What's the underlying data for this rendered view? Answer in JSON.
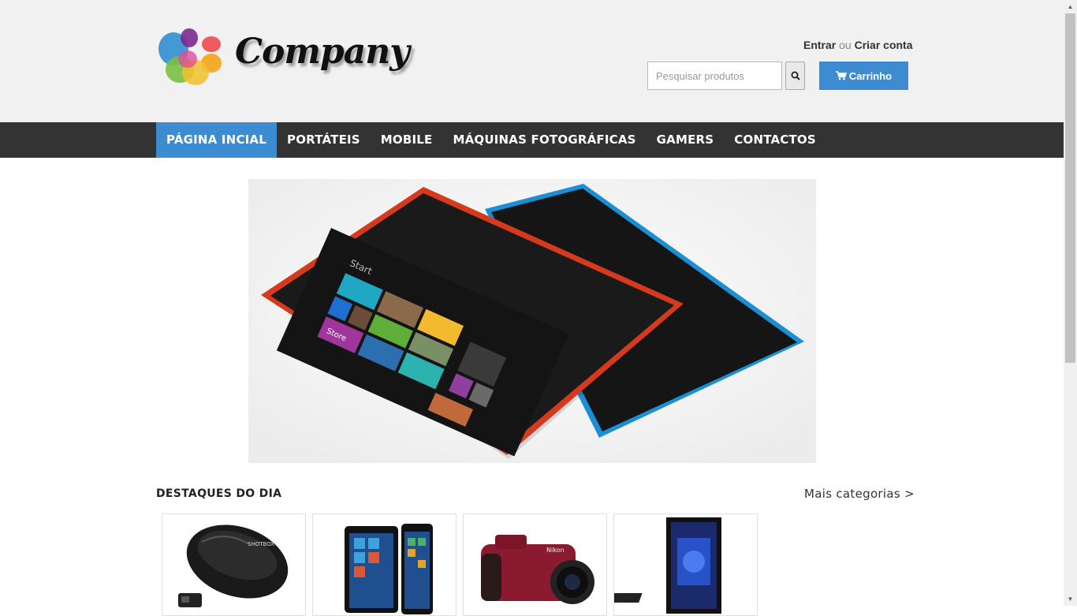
{
  "brand": {
    "name": "Company"
  },
  "account": {
    "login": "Entrar",
    "or": "ou",
    "register": "Criar conta"
  },
  "search": {
    "placeholder": "Pesquisar produtos",
    "value": ""
  },
  "cart": {
    "label": "Carrinho"
  },
  "nav": {
    "items": [
      {
        "label": "PÁGINA INCIAL",
        "active": true
      },
      {
        "label": "PORTÁTEIS"
      },
      {
        "label": "MOBILE"
      },
      {
        "label": "MÁQUINAS FOTOGRÁFICAS"
      },
      {
        "label": "GAMERS"
      },
      {
        "label": "CONTACTOS"
      }
    ]
  },
  "hero": {
    "screen_start": "Start",
    "tile_store": "Store"
  },
  "highlights": {
    "title": "DESTAQUES DO DIA",
    "more": "Mais categorias >",
    "products": [
      {
        "icon": "wireless-mouse-image"
      },
      {
        "icon": "tablets-image"
      },
      {
        "icon": "camera-image"
      },
      {
        "icon": "gaming-pc-image"
      }
    ]
  },
  "colors": {
    "accent": "#3d8bd0",
    "nav_bg": "#333333",
    "header_bg": "#f1f1f1"
  }
}
